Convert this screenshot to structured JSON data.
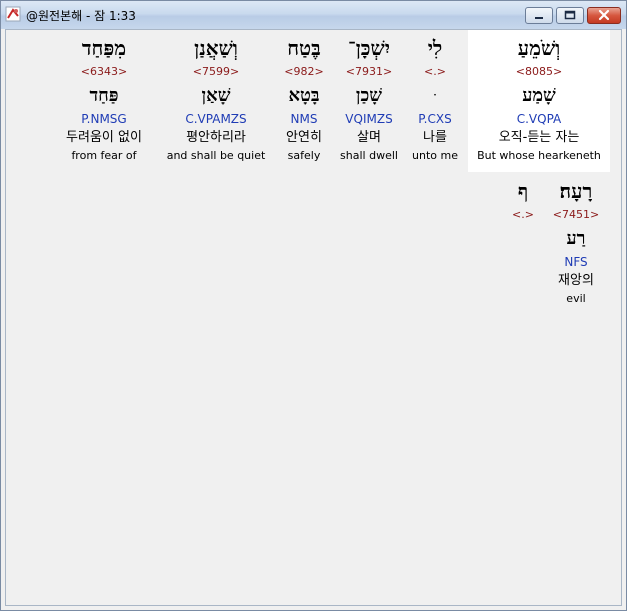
{
  "window": {
    "title": "@원전본해 - 잠 1:33",
    "buttons": {
      "minimize": "minimize-icon",
      "maximize": "maximize-icon",
      "close": "close-icon"
    },
    "colors": {
      "strong": "#8b1a1a",
      "morph": "#1f3cb5",
      "selected_bg": "#ffffff"
    }
  },
  "words": [
    {
      "hebrew": "וְשֹׁמֵעַ",
      "strong": "<8085>",
      "lemma": "שָׁמַע",
      "morph": "C.VQPA",
      "korean": "오직-듣는 자는",
      "english": "But whose hearkeneth",
      "selected": true
    },
    {
      "hebrew": "לִי",
      "strong": "<.>",
      "lemma": "ּ",
      "morph": "P.CXS",
      "korean": "나를",
      "english": "unto me",
      "selected": false
    },
    {
      "hebrew": "יִשְׁכָּן־",
      "strong": "<7931>",
      "lemma": "שָׁכַן",
      "morph": "VQIMZS",
      "korean": "살며",
      "english": "shall dwell",
      "selected": false
    },
    {
      "hebrew": "בֶּטַח",
      "strong": "<982>",
      "lemma": "בָּטָא",
      "morph": "NMS",
      "korean": "안연히",
      "english": "safely",
      "selected": false
    },
    {
      "hebrew": "וְשַׁאֲנַן",
      "strong": "<7599>",
      "lemma": "שָׁאַן",
      "morph": "C.VPAMZS",
      "korean": "평안하리라",
      "english": "and shall be quiet",
      "selected": false
    },
    {
      "hebrew": "מִפַּחַד",
      "strong": "<6343>",
      "lemma": "פַּחַד",
      "morph": "P.NMSG",
      "korean": "두려움이 없이",
      "english": "from fear of",
      "selected": false
    },
    {
      "hebrew": "רָעָה׃",
      "strong": "<7451>",
      "lemma": "רַע",
      "morph": "NFS",
      "korean": "재앙의",
      "english": "evil",
      "selected": false
    },
    {
      "hebrew": "ף",
      "strong": "<.>",
      "lemma": "",
      "morph": "",
      "korean": "",
      "english": "",
      "selected": false
    }
  ]
}
